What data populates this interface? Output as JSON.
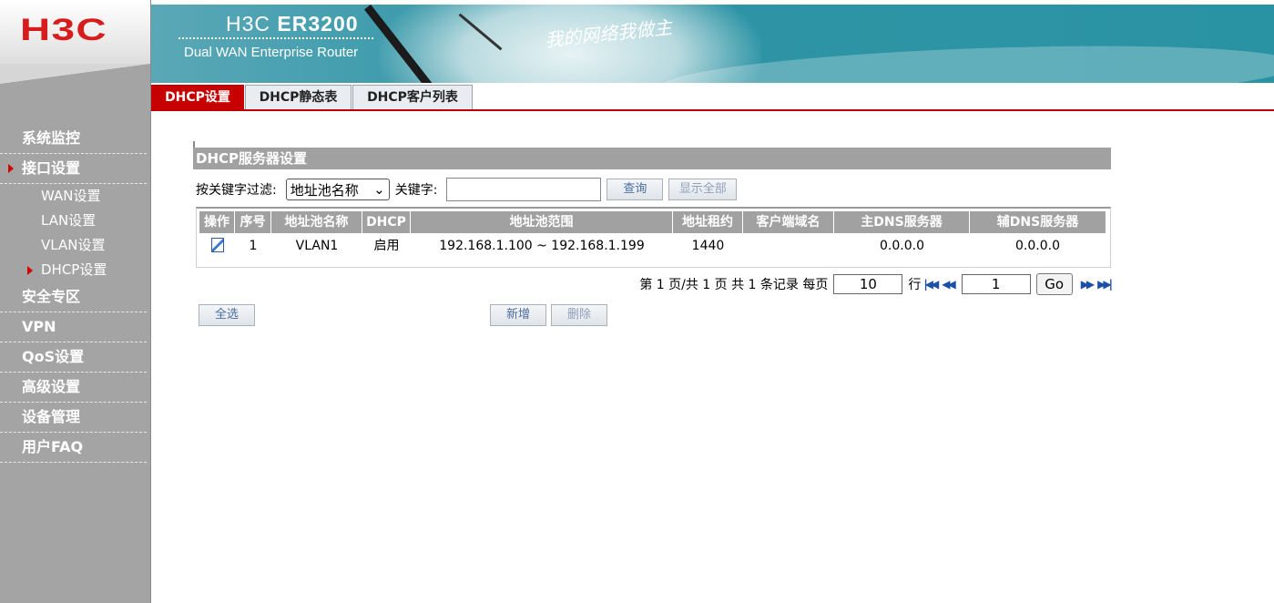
{
  "brand": {
    "logo": "H3C",
    "model": "H3C",
    "model_num": "ER3200",
    "subtitle": "Dual WAN Enterprise Router",
    "slogan": "我的网络我做主"
  },
  "sidebar": {
    "items": [
      {
        "label": "系统监控",
        "active": false
      },
      {
        "label": "接口设置",
        "active": true
      },
      {
        "label": "安全专区",
        "active": false
      },
      {
        "label": "VPN",
        "active": false
      },
      {
        "label": "QoS设置",
        "active": false
      },
      {
        "label": "高级设置",
        "active": false
      },
      {
        "label": "设备管理",
        "active": false
      },
      {
        "label": "用户FAQ",
        "active": false
      }
    ],
    "subitems": [
      {
        "label": "WAN设置",
        "active": false
      },
      {
        "label": "LAN设置",
        "active": false
      },
      {
        "label": "VLAN设置",
        "active": false
      },
      {
        "label": "DHCP设置",
        "active": true
      }
    ]
  },
  "tabs": [
    {
      "label": "DHCP设置",
      "active": true
    },
    {
      "label": "DHCP静态表",
      "active": false
    },
    {
      "label": "DHCP客户列表",
      "active": false
    }
  ],
  "section": {
    "title": "DHCP服务器设置"
  },
  "filter": {
    "label": "按关键字过滤:",
    "field_value": "地址池名称",
    "keyword_label": "关键字:",
    "keyword_value": "",
    "query_button": "查询",
    "show_all_button": "显示全部"
  },
  "table": {
    "columns": [
      "操作",
      "序号",
      "地址池名称",
      "DHCP",
      "地址池范围",
      "地址租约",
      "客户端域名",
      "主DNS服务器",
      "辅DNS服务器"
    ],
    "rows": [
      {
        "seq": "1",
        "pool_name": "VLAN1",
        "dhcp": "启用",
        "range": "192.168.1.100 ~ 192.168.1.199",
        "lease": "1440",
        "domain": "",
        "dns1": "0.0.0.0",
        "dns2": "0.0.0.0"
      }
    ]
  },
  "pager": {
    "summary": "第 1 页/共 1 页 共 1 条记录 每页",
    "per_page": "10",
    "row_unit": "行",
    "page": "1",
    "go": "Go"
  },
  "actions": {
    "select_all": "全选",
    "add": "新增",
    "delete": "删除"
  },
  "colors": {
    "accent_red": "#c70000",
    "banner_teal": "#2f95a6",
    "sidebar_gray": "#a4a4a4",
    "header_gray": "#a1a1a1"
  }
}
